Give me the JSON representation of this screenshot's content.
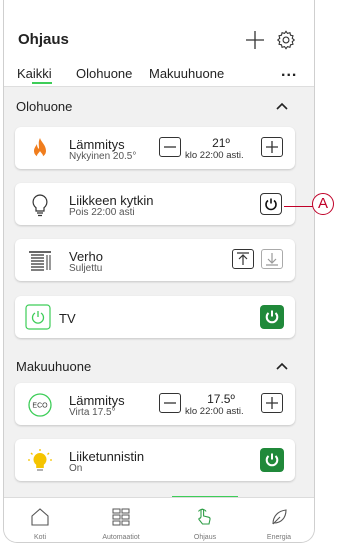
{
  "header": {
    "title": "Ohjaus"
  },
  "tabs": [
    {
      "label": "Kaikki",
      "active": true
    },
    {
      "label": "Olohuone",
      "active": false
    },
    {
      "label": "Makuuhuone",
      "active": false
    }
  ],
  "more_label": "...",
  "sections": {
    "olohuone": "Olohuone",
    "makuuhuone": "Makuuhuone"
  },
  "devices": {
    "heating1": {
      "name": "Lämmitys",
      "sub": "Nykyinen 20.5°",
      "setpoint": "21º",
      "schedule": "klo 22:00 asti."
    },
    "motion_switch": {
      "name": "Liikkeen kytkin",
      "sub": "Pois 22:00 asti"
    },
    "curtain": {
      "name": "Verho",
      "sub": "Suljettu"
    },
    "tv": {
      "name": "TV"
    },
    "heating2": {
      "name": "Lämmitys",
      "sub": "Virta 17.5°",
      "setpoint": "17.5º",
      "schedule": "klo 22:00 asti.",
      "eco_label": "ECO"
    },
    "motion_sensor": {
      "name": "Liiketunnistin",
      "sub": "On"
    }
  },
  "callout": "A",
  "nav": [
    {
      "label": "Koti",
      "icon": "home-icon",
      "active": false
    },
    {
      "label": "Automaatiot",
      "icon": "grid-icon",
      "active": false
    },
    {
      "label": "Ohjaus",
      "icon": "hand-icon",
      "active": true
    },
    {
      "label": "Energia",
      "icon": "leaf-icon",
      "active": false
    }
  ],
  "colors": {
    "accent": "#3dcd58",
    "power_on": "#20893a",
    "flame": "#f07d1d",
    "bulb": "#f5c400",
    "callout": "#c00028"
  }
}
